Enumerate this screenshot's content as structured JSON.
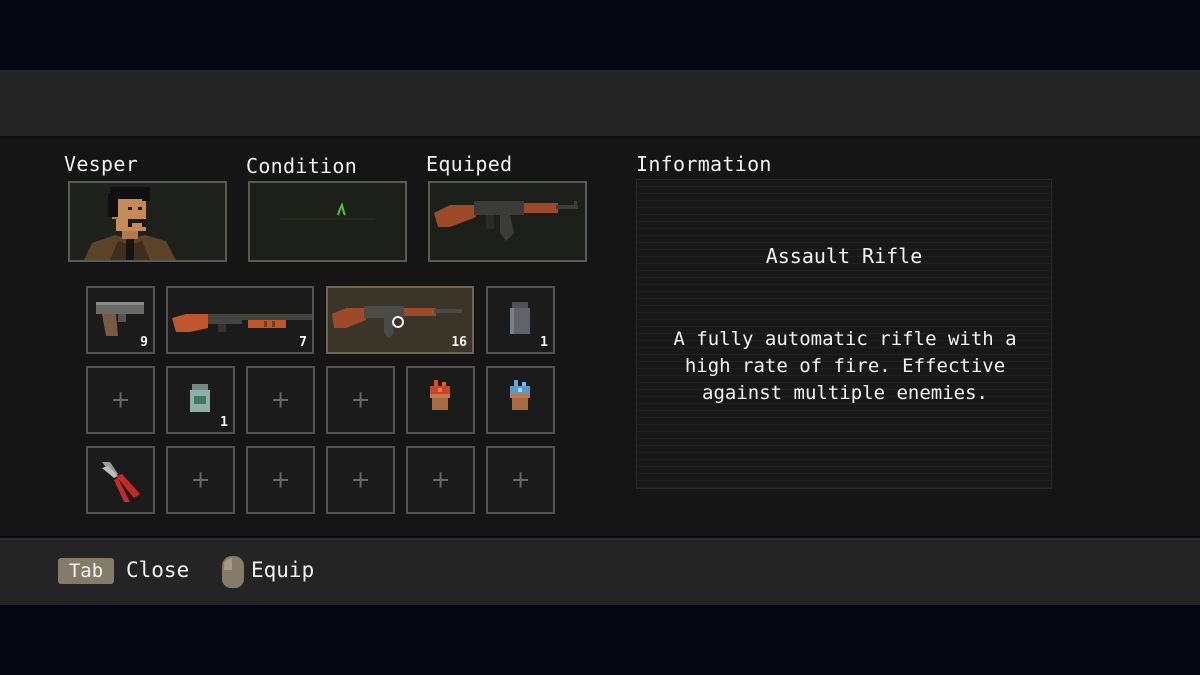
{
  "character": {
    "name": "Vesper",
    "condition_label": "Condition",
    "equipped_label": "Equiped",
    "equipped_weapon": "assault-rifle-icon"
  },
  "information": {
    "label": "Information",
    "item_name": "Assault Rifle",
    "item_description": "A fully automatic rifle with a high rate of fire. Effective against multiple enemies."
  },
  "inventory": {
    "row1": [
      {
        "item": "pistol-icon",
        "count": "9"
      },
      {
        "item": "shotgun-icon",
        "count": "7"
      },
      {
        "item": "assault-rifle-icon",
        "count": "16",
        "selected": true
      },
      {
        "item": "grenade-icon",
        "count": "1"
      }
    ],
    "row2": [
      {
        "item": "empty-slot",
        "symbol": "+"
      },
      {
        "item": "jar-icon",
        "count": "1"
      },
      {
        "item": "empty-slot",
        "symbol": "+"
      },
      {
        "item": "empty-slot",
        "symbol": "+"
      },
      {
        "item": "red-plant-icon"
      },
      {
        "item": "blue-plant-icon"
      }
    ],
    "row3": [
      {
        "item": "pliers-icon"
      },
      {
        "item": "empty-slot",
        "symbol": "+"
      },
      {
        "item": "empty-slot",
        "symbol": "+"
      },
      {
        "item": "empty-slot",
        "symbol": "+"
      },
      {
        "item": "empty-slot",
        "symbol": "+"
      },
      {
        "item": "empty-slot",
        "symbol": "+"
      }
    ]
  },
  "controls": {
    "tab_key": "Tab",
    "tab_action": "Close",
    "mouse_action": "Equip"
  },
  "colors": {
    "panel": "#151515",
    "bar": "#242424",
    "slot_border": "#55554f",
    "selected_slot": "#3a3528",
    "key_bg": "#857b6a",
    "ecg_green": "#5cbf2a"
  }
}
